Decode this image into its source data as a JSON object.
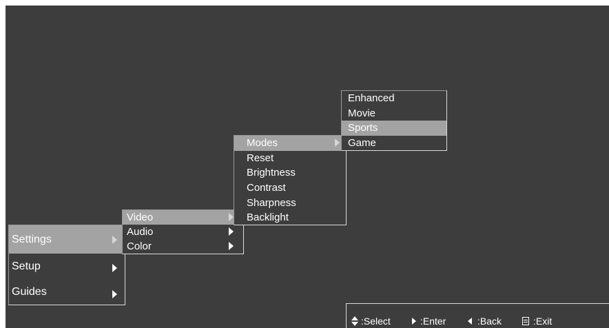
{
  "colors": {
    "screen_background": "#3d3d3d",
    "selected_item_background": "#a3a3a3",
    "text": "#ffffff",
    "border": "#dcdcdc"
  },
  "main_menu": {
    "items": [
      {
        "label": "Settings",
        "selected": true,
        "has_submenu": true
      },
      {
        "label": "Setup",
        "selected": false,
        "has_submenu": true
      },
      {
        "label": "Guides",
        "selected": false,
        "has_submenu": true
      }
    ]
  },
  "video_menu": {
    "items": [
      {
        "label": "Video",
        "selected": true,
        "has_submenu": true
      },
      {
        "label": "Audio",
        "selected": false,
        "has_submenu": true
      },
      {
        "label": "Color",
        "selected": false,
        "has_submenu": true
      }
    ]
  },
  "modes_menu": {
    "items": [
      {
        "label": "Modes",
        "selected": true,
        "has_submenu": true
      },
      {
        "label": "Reset",
        "selected": false,
        "has_submenu": false
      },
      {
        "label": "Brightness",
        "selected": false,
        "has_submenu": false
      },
      {
        "label": "Contrast",
        "selected": false,
        "has_submenu": false
      },
      {
        "label": "Sharpness",
        "selected": false,
        "has_submenu": false
      },
      {
        "label": "Backlight",
        "selected": false,
        "has_submenu": false
      }
    ]
  },
  "picture_mode_menu": {
    "items": [
      {
        "label": "Enhanced",
        "selected": false
      },
      {
        "label": "Movie",
        "selected": false
      },
      {
        "label": "Sports",
        "selected": true
      },
      {
        "label": "Game",
        "selected": false
      }
    ]
  },
  "hint_bar": {
    "select": {
      "icon": "up-down-arrows-icon",
      "label": ":Select"
    },
    "enter": {
      "icon": "right-triangle-icon",
      "label": ":Enter"
    },
    "back": {
      "icon": "left-triangle-icon",
      "label": ":Back"
    },
    "exit": {
      "icon": "menu-document-icon",
      "label": ":Exit"
    }
  }
}
